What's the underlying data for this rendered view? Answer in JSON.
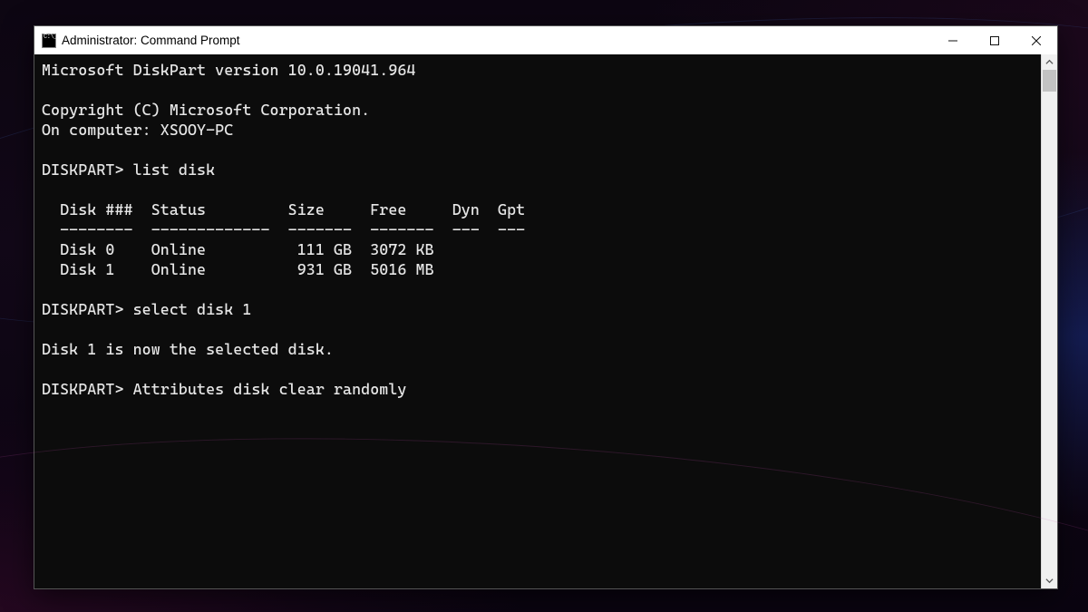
{
  "window": {
    "title": "Administrator: Command Prompt"
  },
  "terminal": {
    "lines": {
      "l0": "Microsoft DiskPart version 10.0.19041.964",
      "l1": "",
      "l2": "Copyright (C) Microsoft Corporation.",
      "l3": "On computer: XSOOY-PC",
      "l4": "",
      "l5": "DISKPART> list disk",
      "l6": "",
      "l7": "  Disk ###  Status         Size     Free     Dyn  Gpt",
      "l8": "  --------  -------------  -------  -------  ---  ---",
      "l9": "  Disk 0    Online          111 GB  3072 KB",
      "l10": "  Disk 1    Online          931 GB  5016 MB",
      "l11": "",
      "l12": "DISKPART> select disk 1",
      "l13": "",
      "l14": "Disk 1 is now the selected disk.",
      "l15": "",
      "l16": "DISKPART> Attributes disk clear randomly"
    }
  }
}
